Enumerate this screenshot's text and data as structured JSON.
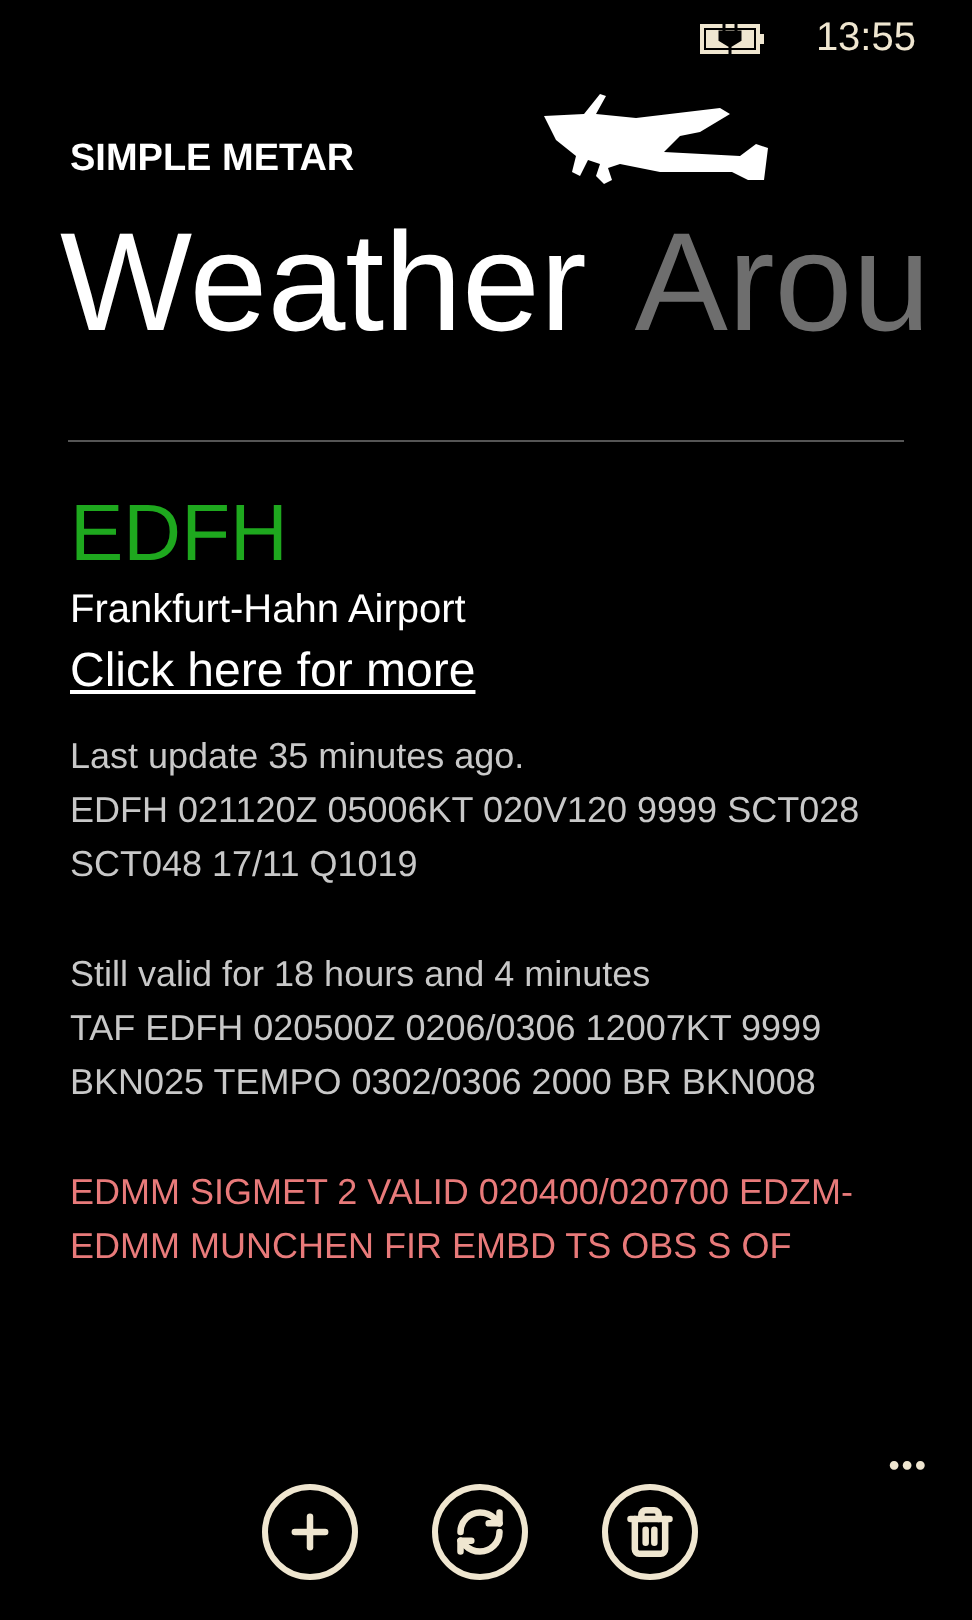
{
  "status_bar": {
    "time": "13:55"
  },
  "app": {
    "name": "SIMPLE METAR"
  },
  "pivot": {
    "items": [
      {
        "label": "Weather",
        "selected": true
      },
      {
        "label": "Arou",
        "selected": false
      }
    ]
  },
  "station": {
    "code": "EDFH",
    "name": "Frankfurt-Hahn Airport",
    "link": "Click here for more"
  },
  "blocks": [
    {
      "kind": "normal",
      "lines": [
        "Last update 35 minutes ago.",
        "EDFH 021120Z 05006KT 020V120 9999 SCT028 SCT048 17/11 Q1019"
      ]
    },
    {
      "kind": "normal",
      "lines": [
        "Still valid for 18 hours and 4 minutes",
        "TAF EDFH 020500Z 0206/0306 12007KT 9999 BKN025 TEMPO 0302/0306 2000 BR BKN008"
      ]
    },
    {
      "kind": "warning",
      "lines": [
        "EDMM SIGMET 2 VALID 020400/020700 EDZM-EDMM MUNCHEN FIR EMBD TS OBS S OF"
      ]
    }
  ],
  "app_bar": {
    "buttons": [
      {
        "kind": "add"
      },
      {
        "kind": "refresh"
      },
      {
        "kind": "delete"
      }
    ],
    "more": "•••"
  }
}
